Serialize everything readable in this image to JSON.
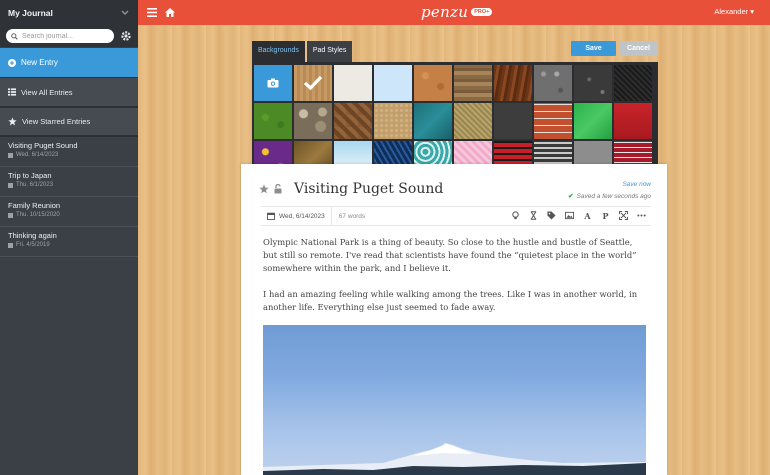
{
  "sidebar": {
    "title": "My Journal",
    "search_placeholder": "Search journal...",
    "new_entry_label": "New Entry",
    "view_all_label": "View All Entries",
    "view_starred_label": "View Starred Entries",
    "entries": [
      {
        "title": "Visiting Puget Sound",
        "date": "Wed. 6/14/2023"
      },
      {
        "title": "Trip to Japan",
        "date": "Thu. 6/1/2023"
      },
      {
        "title": "Family Reunion",
        "date": "Thu. 10/15/2020"
      },
      {
        "title": "Thinking again",
        "date": "Fri. 4/5/2019"
      }
    ]
  },
  "topbar": {
    "logo_text": "penzu",
    "pro_badge": "PRO+",
    "user_name": "Alexander ▾"
  },
  "style_panel": {
    "tabs": [
      {
        "label": "Backgrounds",
        "active": true
      },
      {
        "label": "Pad Styles",
        "active": false
      }
    ],
    "save_label": "Save",
    "cancel_label": "Cancel"
  },
  "entry": {
    "title": "Visiting Puget Sound",
    "save_now": "Save now",
    "saved_status": "Saved a few seconds ago",
    "date": "Wed, 6/14/2023",
    "word_count": "67 words",
    "paragraphs": [
      "Olympic National Park is a thing of beauty. So close to the hustle and bustle of Seattle, but still so remote. I've read that scientists have found the “quietest place in the world” somewhere within the park, and I believe it.",
      "I had an amazing feeling while walking among the trees. Like I was in another world, in another life. Everything else just seemed to fade away."
    ]
  },
  "colors": {
    "accent": "#3a9ad9",
    "topbar": "#e8503a",
    "sidebar": "#3b4046"
  }
}
